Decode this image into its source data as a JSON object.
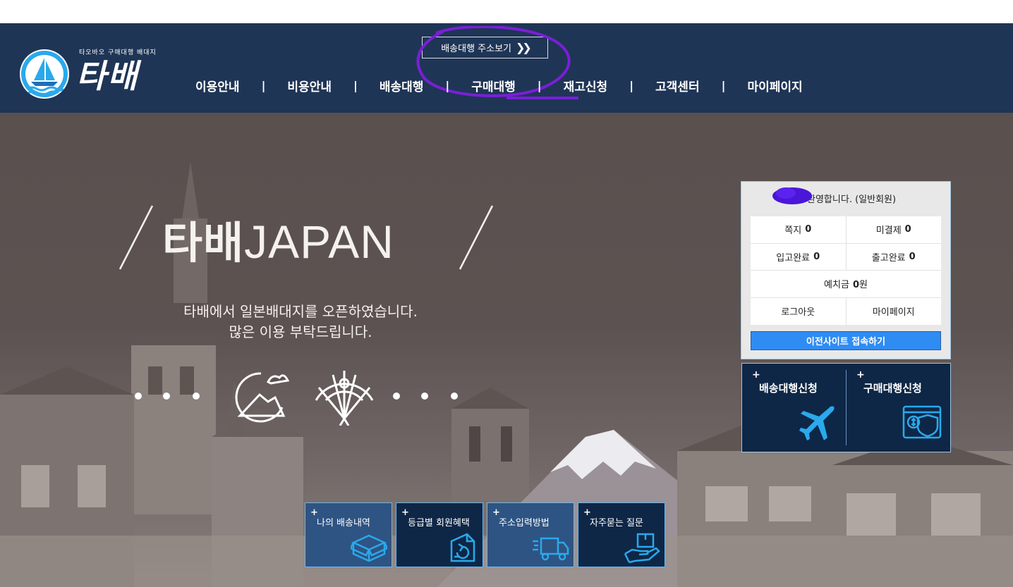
{
  "header": {
    "logo_tagline": "타오바오 구매대행 배대지",
    "logo_word": "타배",
    "address_button": "배송대행 주소보기",
    "nav": [
      "이용안내",
      "비용안내",
      "배송대행",
      "구매대행",
      "재고신청",
      "고객센터",
      "마이페이지"
    ],
    "nav_separator": "|"
  },
  "hero": {
    "brand_name": "타배",
    "brand_suffix": "JAPAN",
    "message_line1": "타배에서 일본배대지를 오픈하였습니다.",
    "message_line2": "많은 이용 부탁드립니다."
  },
  "member": {
    "welcome": "님 환영합니다. (일반회원)",
    "stats": [
      [
        {
          "label": "쪽지",
          "value": "0"
        },
        {
          "label": "미결제",
          "value": "0"
        }
      ],
      [
        {
          "label": "입고완료",
          "value": "0"
        },
        {
          "label": "출고완료",
          "value": "0"
        }
      ]
    ],
    "deposit_label": "예치금",
    "deposit_value": "0",
    "deposit_unit": "원",
    "logout": "로그아웃",
    "mypage": "마이페이지",
    "prev_site": "이전사이트 접속하기"
  },
  "services": [
    {
      "label": "배송대행신청",
      "icon": "airplane-icon"
    },
    {
      "label": "구매대행신청",
      "icon": "payment-shield-icon"
    }
  ],
  "tiles": [
    {
      "label": "나의 배송내역",
      "icon": "box-icon",
      "style": "light"
    },
    {
      "label": "등급별 회원혜택",
      "icon": "return-box-icon",
      "style": "dark"
    },
    {
      "label": "주소입력방법",
      "icon": "delivery-truck-icon",
      "style": "light"
    },
    {
      "label": "자주묻는 질문",
      "icon": "hand-box-icon",
      "style": "dark"
    }
  ],
  "plus_sign": "+",
  "colors": {
    "header_bg": "#1f3556",
    "hero_bg": "#5a504e",
    "accent_blue": "#2f8cf2",
    "tile_dark": "#0e2747",
    "tile_light": "#2e5483",
    "icon_cyan": "#2aa9ec",
    "annotation_purple": "#7a1fd6"
  }
}
